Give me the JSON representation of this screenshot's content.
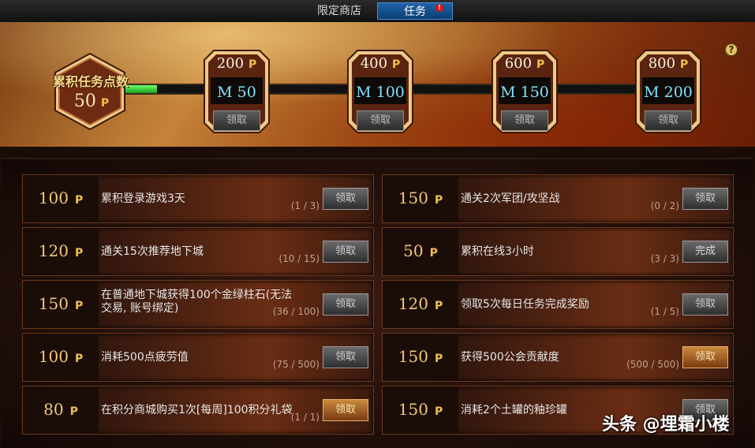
{
  "tabs": {
    "shop": "限定商店",
    "task": "任务",
    "alert": "!"
  },
  "summary": {
    "title": "累积任务点数",
    "value": "50",
    "unit": "P",
    "progress_fraction": 0.07
  },
  "help_label": "?",
  "milestones": [
    {
      "points": "200",
      "unit": "P",
      "reward": "50",
      "reward_prefix": "M",
      "button": "领取"
    },
    {
      "points": "400",
      "unit": "P",
      "reward": "100",
      "reward_prefix": "M",
      "button": "领取"
    },
    {
      "points": "600",
      "unit": "P",
      "reward": "150",
      "reward_prefix": "M",
      "button": "领取"
    },
    {
      "points": "800",
      "unit": "P",
      "reward": "200",
      "reward_prefix": "M",
      "button": "领取"
    }
  ],
  "tasks_left": [
    {
      "points": "100",
      "unit": "P",
      "desc": "累积登录游戏3天",
      "progress": "(1 / 3)",
      "button": "领取",
      "state": "normal"
    },
    {
      "points": "120",
      "unit": "P",
      "desc": "通关15次推荐地下城",
      "progress": "(10 / 15)",
      "button": "领取",
      "state": "normal"
    },
    {
      "points": "150",
      "unit": "P",
      "desc": "在普通地下城获得100个金绿柱石(无法交易, 账号绑定)",
      "progress": "(36 / 100)",
      "button": "领取",
      "state": "normal"
    },
    {
      "points": "100",
      "unit": "P",
      "desc": "消耗500点疲劳值",
      "progress": "(75 / 500)",
      "button": "领取",
      "state": "normal"
    },
    {
      "points": "80",
      "unit": "P",
      "desc": "在积分商城购买1次[每周]100积分礼袋",
      "progress": "(1 / 1)",
      "button": "领取",
      "state": "active"
    }
  ],
  "tasks_right": [
    {
      "points": "150",
      "unit": "P",
      "desc": "通关2次军团/攻坚战",
      "progress": "(0 / 2)",
      "button": "领取",
      "state": "normal"
    },
    {
      "points": "50",
      "unit": "P",
      "desc": "累积在线3小时",
      "progress": "(3 / 3)",
      "button": "完成",
      "state": "done"
    },
    {
      "points": "120",
      "unit": "P",
      "desc": "领取5次每日任务完成奖励",
      "progress": "(1 / 5)",
      "button": "领取",
      "state": "normal"
    },
    {
      "points": "150",
      "unit": "P",
      "desc": "获得500公会贡献度",
      "progress": "(500 / 500)",
      "button": "领取",
      "state": "active"
    },
    {
      "points": "150",
      "unit": "P",
      "desc": "消耗2个土罐的釉珍罐",
      "progress": "",
      "button": "领取",
      "state": "normal"
    }
  ],
  "watermark": "头条 @埋霜小楼",
  "colors": {
    "accent_blue": "#1f63a8",
    "gold": "#f0c050",
    "progress_green": "#1ea01e",
    "reward_cyan": "#7fe3ff"
  }
}
